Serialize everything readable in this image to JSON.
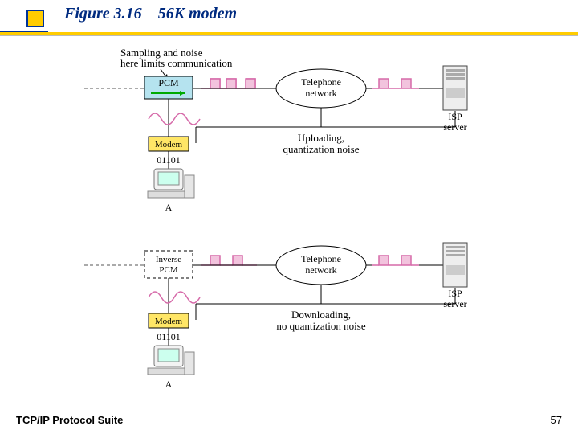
{
  "title": {
    "figure_label": "Figure 3.16",
    "caption": "56K modem"
  },
  "footer": {
    "left": "TCP/IP Protocol Suite",
    "page": "57"
  },
  "diagram": {
    "sampling_note_l1": "Sampling and noise",
    "sampling_note_l2": "here limits communication",
    "pcm": "PCM",
    "inverse_pcm_l1": "Inverse",
    "inverse_pcm_l2": "PCM",
    "modem": "Modem",
    "modem2": "Modem",
    "bits": "01101",
    "bits2": "01101",
    "telnet": "Telephone",
    "telnet_l2": "network",
    "telnet2": "Telephone",
    "telnet2_l2": "network",
    "isp": "ISP",
    "isp_l2": "server",
    "isp2": "ISP",
    "isp2_l2": "server",
    "upload_l1": "Uploading,",
    "upload_l2": "quantization noise",
    "download_l1": "Downloading,",
    "download_l2": "no quantization noise",
    "a_label": "A",
    "a_label2": "A"
  }
}
